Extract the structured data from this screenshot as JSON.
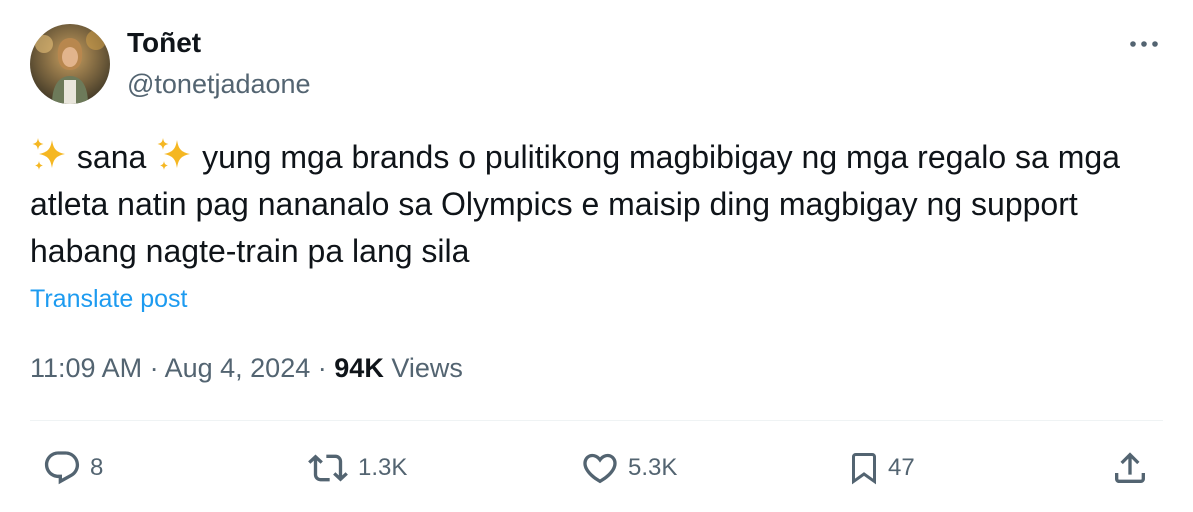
{
  "author": {
    "name": "Toñet",
    "handle": "@tonetjadaone"
  },
  "tweet": {
    "sparkle_1": "✨",
    "word_1": "sana",
    "sparkle_2": "✨",
    "body": "yung mga brands o pulitikong magbibigay ng mga regalo sa mga atleta natin pag nananalo sa Olympics e maisip ding magbigay ng support habang nagte-train pa lang sila",
    "translate_label": "Translate post"
  },
  "meta": {
    "time": "11:09 AM",
    "separator": "·",
    "date": "Aug 4, 2024",
    "views_count": "94K",
    "views_label": "Views"
  },
  "actions": {
    "replies": "8",
    "reposts": "1.3K",
    "likes": "5.3K",
    "bookmarks": "47"
  },
  "icons": {
    "more": "more-horizontal-icon",
    "reply": "reply-bubble-icon",
    "repost": "repost-arrows-icon",
    "like": "heart-icon",
    "bookmark": "bookmark-icon",
    "share": "share-upload-icon"
  },
  "colors": {
    "text": "#0f1419",
    "secondary": "#536471",
    "link": "#1d9bf0",
    "divider": "#eff3f4",
    "sparkle": "#f5b722"
  }
}
